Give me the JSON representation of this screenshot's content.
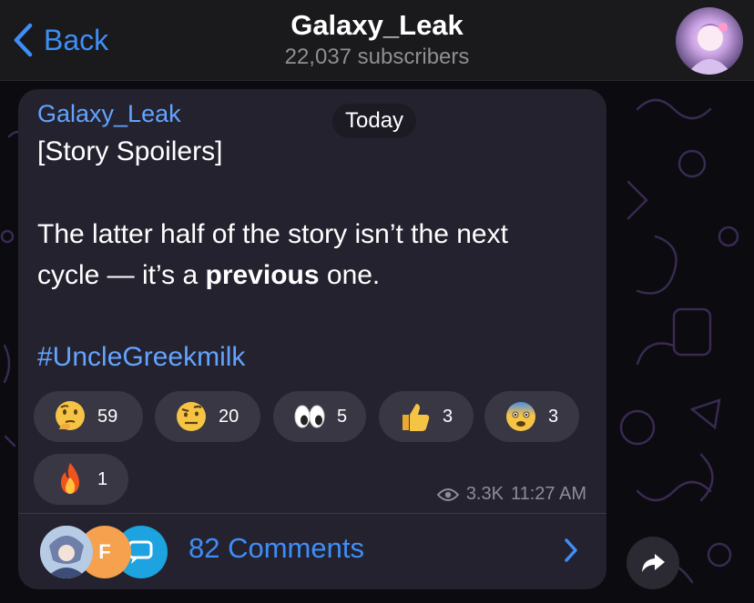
{
  "header": {
    "back_label": "Back",
    "channel_title": "Galaxy_Leak",
    "subscribers": "22,037 subscribers"
  },
  "post": {
    "author": "Galaxy_Leak",
    "date_badge": "Today",
    "line1": "[Story Spoilers]",
    "line2": "The latter half of the story isn’t the next",
    "line3_pre": "cycle — it’s a ",
    "line3_bold": "previous",
    "line3_post": " one.",
    "hashtag": "#UncleGreekmilk",
    "reactions": [
      {
        "emoji": "thinking-face",
        "count": "59"
      },
      {
        "emoji": "raised-eyebrow-face",
        "count": "20"
      },
      {
        "emoji": "eyes",
        "count": "5"
      },
      {
        "emoji": "thumbs-up",
        "count": "3"
      },
      {
        "emoji": "fearful-face",
        "count": "3"
      },
      {
        "emoji": "fire",
        "count": "1"
      }
    ],
    "views": "3.3K",
    "time": "11:27 AM",
    "comments_label": "82 Comments",
    "commenter_initial": "F"
  },
  "colors": {
    "accent": "#3e8ef7",
    "link": "#62a4ff",
    "bubble": "#25222f",
    "reaction_bg": "#3a3745"
  }
}
